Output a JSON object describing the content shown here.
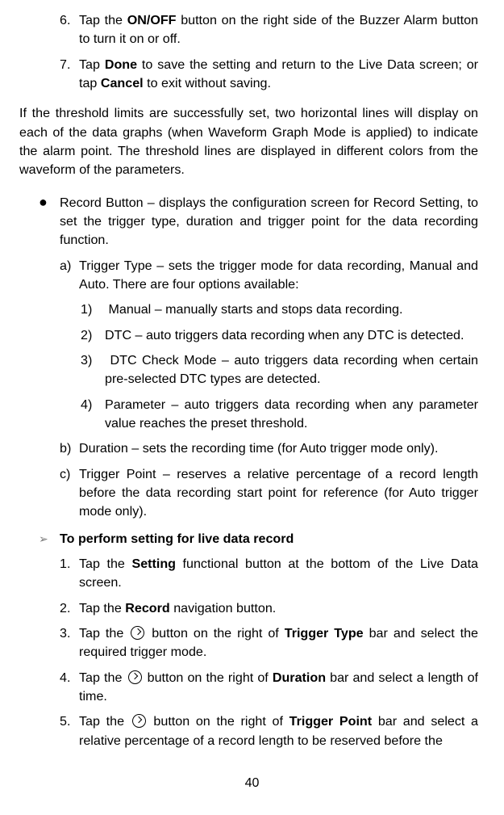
{
  "step6_a": "6.",
  "step6_b": "Tap the ",
  "step6_c": "ON/OFF",
  "step6_d": " button on the right side of the Buzzer Alarm button to turn it on or off.",
  "step7_a": "7.",
  "step7_b": "Tap ",
  "step7_c": "Done",
  "step7_d": " to save the setting and return to the Live Data screen; or tap ",
  "step7_e": "Cancel",
  "step7_f": " to exit without saving.",
  "para1": "If the threshold limits are successfully set, two horizontal lines will display on each of the data graphs (when Waveform Graph Mode is applied) to indicate the alarm point. The threshold lines are displayed in different colors from the waveform of the parameters.",
  "bullet1": "Record Button – displays the configuration screen for Record Setting, to set the trigger type, duration and trigger point for the data recording function.",
  "a_lbl": "a)",
  "a_txt": "Trigger Type – sets the trigger mode for data recording, Manual and Auto. There are four options available:",
  "n1_lbl": "1)",
  "n1_txt": " Manual – manually starts and stops data recording.",
  "n2_lbl": "2)",
  "n2_txt": "DTC – auto triggers data recording when any DTC is detected.",
  "n3_lbl": "3)",
  "n3_txt": " DTC Check Mode – auto triggers data recording when certain pre-selected DTC types are detected.",
  "n4_lbl": "4)",
  "n4_txt": "Parameter – auto triggers data recording when any parameter value reaches the preset threshold.",
  "b_lbl": "b)",
  "b_txt": "Duration – sets the recording time (for Auto trigger mode only).",
  "c_lbl": "c)",
  "c_txt": "Trigger Point – reserves a relative percentage of a record length before the data recording start point for reference (for Auto trigger mode only).",
  "arrow": "➢",
  "arrow_head_txt": "To perform setting for live data record",
  "p1_a": "1.",
  "p1_b": "Tap the ",
  "p1_c": "Setting",
  "p1_d": " functional button at the bottom of the Live Data screen.",
  "p2_a": "2.",
  "p2_b": "Tap the ",
  "p2_c": "Record",
  "p2_d": " navigation button.",
  "p3_a": "3.",
  "p3_b": "Tap the ",
  "p3_c": " button on the right of ",
  "p3_d": "Trigger Type",
  "p3_e": " bar and select the required trigger mode.",
  "p4_a": "4.",
  "p4_b": "Tap the ",
  "p4_c": " button on the right of ",
  "p4_d": "Duration",
  "p4_e": " bar and select a length of time.",
  "p5_a": "5.",
  "p5_b": "Tap the ",
  "p5_c": " button on the right of ",
  "p5_d": "Trigger Point",
  "p5_e": " bar and select a relative percentage of a record length to be reserved before the",
  "page_number": "40"
}
